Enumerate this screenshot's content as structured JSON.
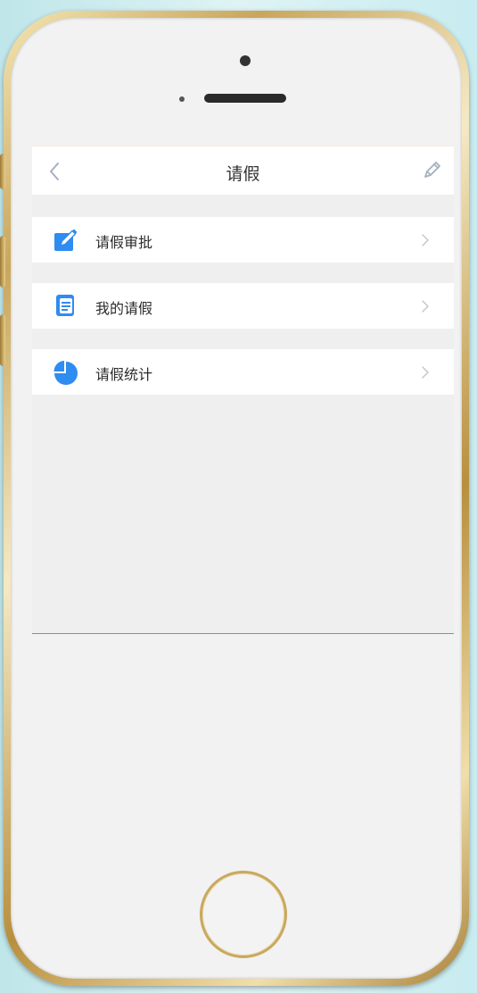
{
  "nav": {
    "title": "请假",
    "back_icon": "chevron-left-icon",
    "edit_icon": "pencil-icon"
  },
  "menu": {
    "items": [
      {
        "label": "请假审批",
        "icon": "edit-note-icon"
      },
      {
        "label": "我的请假",
        "icon": "document-icon"
      },
      {
        "label": "请假统计",
        "icon": "pie-chart-icon"
      }
    ]
  },
  "colors": {
    "accent": "#2f8cf0",
    "nav_icon": "#a3b0c2",
    "screen_bg": "#efefef",
    "phone_gold": "#c9a65c"
  }
}
